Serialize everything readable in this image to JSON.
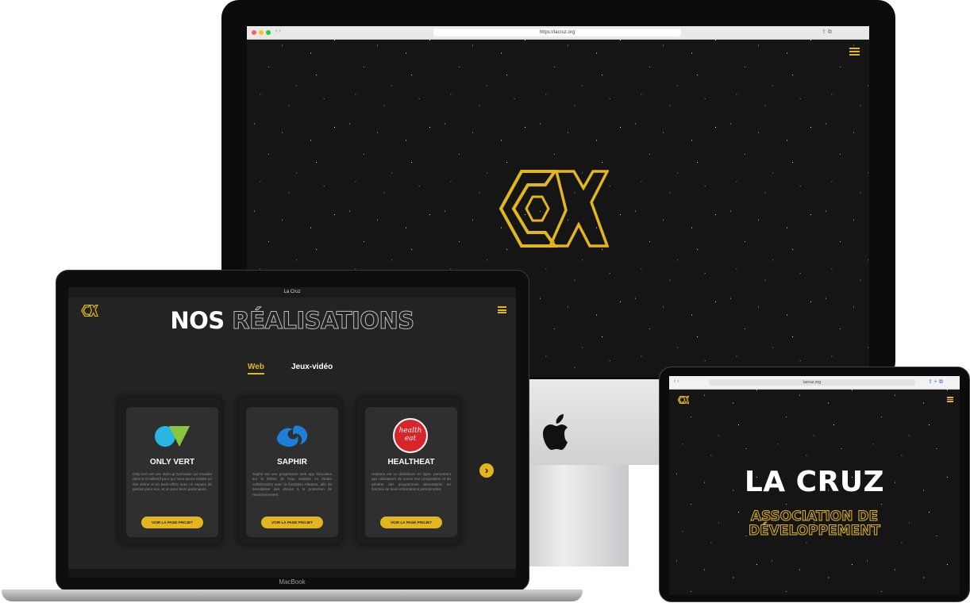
{
  "imac": {
    "url": "https://lacruz.org",
    "logo_icon": "cx-logo-icon",
    "menu_icon": "hamburger-icon",
    "brand_icon": "apple-logo-icon"
  },
  "macbook": {
    "window_title": "La Cruz",
    "logo_icon": "cx-logo-icon",
    "menu_icon": "hamburger-icon",
    "heading": {
      "solid": "NOS",
      "outline": "RÉALISATIONS"
    },
    "tabs": [
      {
        "label": "Web",
        "active": true
      },
      {
        "label": "Jeux-vidéo",
        "active": false
      }
    ],
    "cards": [
      {
        "title": "ONLY VERT",
        "icon": "only-vert-logo-icon",
        "description": "Only-vert est une start-up lyonnaise qui travaille dans le tri-sélectif pour qui nous avons réalisé un site vitrine et un back-office avec un espace de gestion pour eux, et un pour leurs partenaires.",
        "button": "VOIR LA PAGE PROJET"
      },
      {
        "title": "SAPHIR",
        "icon": "saphir-logo-icon",
        "description": "Saphir est une progressive web app éducative sur le thème de l'eau réalisée en étroite collaboration avec la fondation Albatros, afin de sensibiliser des élèves à la protection de l'environnement.",
        "button": "VOIR LA PAGE PROJET"
      },
      {
        "title": "HEALTHEAT",
        "icon": "health-eat-logo-icon",
        "logo_text_1": "health",
        "logo_text_2": "eat",
        "description": "Healteat est un diététicien en ligne, permettant aux utilisateurs de suivre leur progression et de générer des programmes alimentaires en fonction de leurs informations personnelles.",
        "button": "VOIR LA PAGE PROJET"
      }
    ],
    "next_icon": "chevron-right-circle-icon",
    "base_label": "MacBook"
  },
  "ipad": {
    "url": "lacruz.org",
    "logo_icon": "cx-logo-icon",
    "menu_icon": "hamburger-icon",
    "title": "LA CRUZ",
    "subtitle_line1": "ASSOCIATION DE",
    "subtitle_line2": "DÉVELOPPEMENT"
  },
  "colors": {
    "accent": "#e3b51f",
    "background": "#151515",
    "card": "#2f2f2f"
  }
}
